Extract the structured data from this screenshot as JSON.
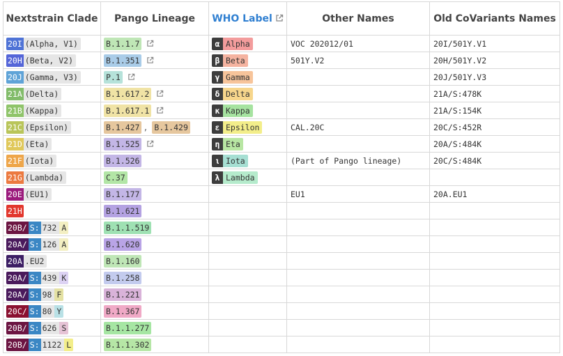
{
  "headers": {
    "clade": "Nextstrain Clade",
    "pango": "Pango Lineage",
    "who": "WHO Label",
    "other": "Other Names",
    "old": "Old CoVariants Names"
  },
  "rows": [
    {
      "clade_parts": [
        {
          "t": "20I",
          "c": "#4f73d6"
        }
      ],
      "clade_label": "(Alpha, V1)",
      "pango": [
        {
          "t": "B.1.1.7",
          "bg": "#bfe6b6",
          "link": true
        }
      ],
      "greek": "α",
      "who": "Alpha",
      "who_bg": "#f39c9c",
      "other": "VOC 202012/01",
      "old": "20I/501Y.V1"
    },
    {
      "clade_parts": [
        {
          "t": "20H",
          "c": "#5465d8"
        }
      ],
      "clade_label": "(Beta, V2)",
      "pango": [
        {
          "t": "B.1.351",
          "bg": "#a9cce8",
          "link": true
        }
      ],
      "greek": "β",
      "who": "Beta",
      "who_bg": "#f5b3a0",
      "other": "501Y.V2",
      "old": "20H/501Y.V2"
    },
    {
      "clade_parts": [
        {
          "t": "20J",
          "c": "#5fa3d7"
        }
      ],
      "clade_label": "(Gamma, V3)",
      "pango": [
        {
          "t": "P.1",
          "bg": "#b6e2da",
          "link": true
        }
      ],
      "greek": "γ",
      "who": "Gamma",
      "who_bg": "#f7c49a",
      "other": "",
      "old": "20J/501Y.V3"
    },
    {
      "clade_parts": [
        {
          "t": "21A",
          "c": "#82bc6a"
        }
      ],
      "clade_label": "(Delta)",
      "pango": [
        {
          "t": "B.1.617.2",
          "bg": "#f0e3a5",
          "link": true
        }
      ],
      "greek": "δ",
      "who": "Delta",
      "who_bg": "#f7d68c",
      "other": "",
      "old": "21A/S:478K"
    },
    {
      "clade_parts": [
        {
          "t": "21B",
          "c": "#8fc46a"
        }
      ],
      "clade_label": "(Kappa)",
      "pango": [
        {
          "t": "B.1.617.1",
          "bg": "#f0e3a5",
          "link": true
        }
      ],
      "greek": "κ",
      "who": "Kappa",
      "who_bg": "#a6e3a0",
      "other": "",
      "old": "21A/S:154K"
    },
    {
      "clade_parts": [
        {
          "t": "21C",
          "c": "#b9c55a"
        }
      ],
      "clade_label": "(Epsilon)",
      "pango": [
        {
          "t": "B.1.427",
          "bg": "#e6c79e",
          "link": false
        },
        {
          "t": "B.1.429",
          "bg": "#e6c79e",
          "link": false
        }
      ],
      "greek": "ε",
      "who": "Epsilon",
      "who_bg": "#f3ee8a",
      "other": "CAL.20C",
      "old": "20C/S:452R"
    },
    {
      "clade_parts": [
        {
          "t": "21D",
          "c": "#e0c85a"
        }
      ],
      "clade_label": "(Eta)",
      "pango": [
        {
          "t": "B.1.525",
          "bg": "#c3b6e6",
          "link": true
        }
      ],
      "greek": "η",
      "who": "Eta",
      "who_bg": "#b8e6a3",
      "other": "",
      "old": "20A/S:484K"
    },
    {
      "clade_parts": [
        {
          "t": "21F",
          "c": "#eea64a"
        }
      ],
      "clade_label": "(Iota)",
      "pango": [
        {
          "t": "B.1.526",
          "bg": "#c3b6e6",
          "link": false
        }
      ],
      "greek": "ι",
      "who": "Iota",
      "who_bg": "#a6dfd3",
      "other": "(Part of Pango lineage)",
      "old": "20C/S:484K"
    },
    {
      "clade_parts": [
        {
          "t": "21G",
          "c": "#ec7a40"
        }
      ],
      "clade_label": "(Lambda)",
      "pango": [
        {
          "t": "C.37",
          "bg": "#b3e6a6",
          "link": false
        }
      ],
      "greek": "λ",
      "who": "Lambda",
      "who_bg": "#b5ebcc",
      "other": "",
      "old": ""
    },
    {
      "clade_parts": [
        {
          "t": "20E",
          "c": "#9b1a7c"
        }
      ],
      "clade_label": "(EU1)",
      "pango": [
        {
          "t": "B.1.177",
          "bg": "#c3b6e6",
          "link": false
        }
      ],
      "greek": "",
      "who": "",
      "who_bg": "",
      "other": "EU1",
      "old": "20A.EU1"
    },
    {
      "clade_parts": [
        {
          "t": "21H",
          "c": "#e2372d"
        }
      ],
      "clade_label": "",
      "pango": [
        {
          "t": "B.1.621",
          "bg": "#b4a2e2",
          "link": false
        }
      ],
      "greek": "",
      "who": "",
      "who_bg": "",
      "other": "",
      "old": ""
    },
    {
      "clade_parts": [
        {
          "t": "20B/",
          "c": "#6c1542"
        },
        {
          "t": "S:",
          "c": "#3b87c4"
        }
      ],
      "clade_label": "732",
      "clade_suffix": {
        "t": "A",
        "c": "#f3efc2"
      },
      "pango": [
        {
          "t": "B.1.1.519",
          "bg": "#9fe1b3",
          "link": false
        }
      ],
      "greek": "",
      "who": "",
      "who_bg": "",
      "other": "",
      "old": ""
    },
    {
      "clade_parts": [
        {
          "t": "20A/",
          "c": "#4a1a5c"
        },
        {
          "t": "S:",
          "c": "#3b87c4"
        }
      ],
      "clade_label": "126",
      "clade_suffix": {
        "t": "A",
        "c": "#f3efc2"
      },
      "pango": [
        {
          "t": "B.1.620",
          "bg": "#b9a4e6",
          "link": false
        }
      ],
      "greek": "",
      "who": "",
      "who_bg": "",
      "other": "",
      "old": ""
    },
    {
      "clade_parts": [
        {
          "t": "20A",
          "c": "#3c1e64"
        }
      ],
      "clade_label": ".EU2",
      "pango": [
        {
          "t": "B.1.160",
          "bg": "#bfe6b6",
          "link": false
        }
      ],
      "greek": "",
      "who": "",
      "who_bg": "",
      "other": "",
      "old": ""
    },
    {
      "clade_parts": [
        {
          "t": "20A/",
          "c": "#4a1a5c"
        },
        {
          "t": "S:",
          "c": "#3b87c4"
        }
      ],
      "clade_label": "439",
      "clade_suffix": {
        "t": "K",
        "c": "#dcd2f3"
      },
      "pango": [
        {
          "t": "B.1.258",
          "bg": "#c3cbee",
          "link": false
        }
      ],
      "greek": "",
      "who": "",
      "who_bg": "",
      "other": "",
      "old": ""
    },
    {
      "clade_parts": [
        {
          "t": "20A/",
          "c": "#4a1a5c"
        },
        {
          "t": "S:",
          "c": "#3b87c4"
        }
      ],
      "clade_label": "98",
      "clade_suffix": {
        "t": "F",
        "c": "#e4e1a3"
      },
      "pango": [
        {
          "t": "B.1.221",
          "bg": "#d9b3d9",
          "link": false
        }
      ],
      "greek": "",
      "who": "",
      "who_bg": "",
      "other": "",
      "old": ""
    },
    {
      "clade_parts": [
        {
          "t": "20C/",
          "c": "#8a1030"
        },
        {
          "t": "S:",
          "c": "#3b87c4"
        }
      ],
      "clade_label": "80",
      "clade_suffix": {
        "t": "Y",
        "c": "#b9e1e6"
      },
      "pango": [
        {
          "t": "B.1.367",
          "bg": "#f0a9c6",
          "link": false
        }
      ],
      "greek": "",
      "who": "",
      "who_bg": "",
      "other": "",
      "old": ""
    },
    {
      "clade_parts": [
        {
          "t": "20B/",
          "c": "#6c1542"
        },
        {
          "t": "S:",
          "c": "#3b87c4"
        }
      ],
      "clade_label": "626",
      "clade_suffix": {
        "t": "S",
        "c": "#e6c3d6"
      },
      "pango": [
        {
          "t": "B.1.1.277",
          "bg": "#a6e6a3",
          "link": false
        }
      ],
      "greek": "",
      "who": "",
      "who_bg": "",
      "other": "",
      "old": ""
    },
    {
      "clade_parts": [
        {
          "t": "20B/",
          "c": "#6c1542"
        },
        {
          "t": "S:",
          "c": "#3b87c4"
        }
      ],
      "clade_label": "1122",
      "clade_suffix": {
        "t": "L",
        "c": "#f3ee8a"
      },
      "pango": [
        {
          "t": "B.1.1.302",
          "bg": "#b6e6a6",
          "link": false
        }
      ],
      "greek": "",
      "who": "",
      "who_bg": "",
      "other": "",
      "old": ""
    }
  ]
}
